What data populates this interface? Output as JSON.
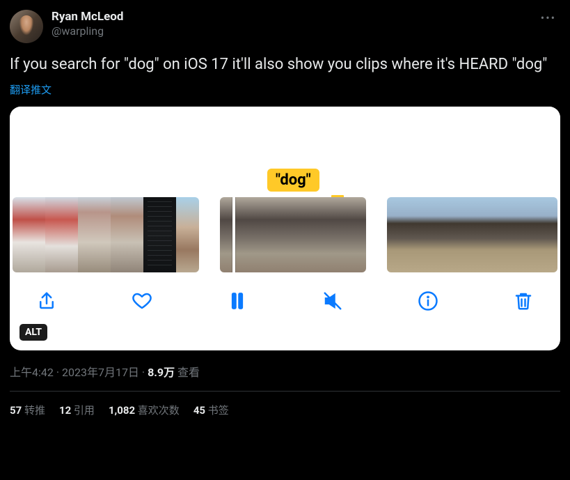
{
  "author": {
    "display_name": "Ryan McLeod",
    "handle": "@warpling"
  },
  "tweet_text": "If you search for \"dog\" on iOS 17 it'll also show you clips where it's HEARD \"dog\"",
  "translate_label": "翻译推文",
  "media": {
    "highlight_token": "\"dog\"",
    "alt_badge": "ALT"
  },
  "meta": {
    "time": "上午4:42",
    "date": "2023年7月17日",
    "views_count": "8.9万",
    "views_label": "查看",
    "separator": " · "
  },
  "stats": {
    "retweets": {
      "count": "57",
      "label": "转推"
    },
    "quotes": {
      "count": "12",
      "label": "引用"
    },
    "likes": {
      "count": "1,082",
      "label": "喜欢次数"
    },
    "bookmarks": {
      "count": "45",
      "label": "书签"
    }
  }
}
